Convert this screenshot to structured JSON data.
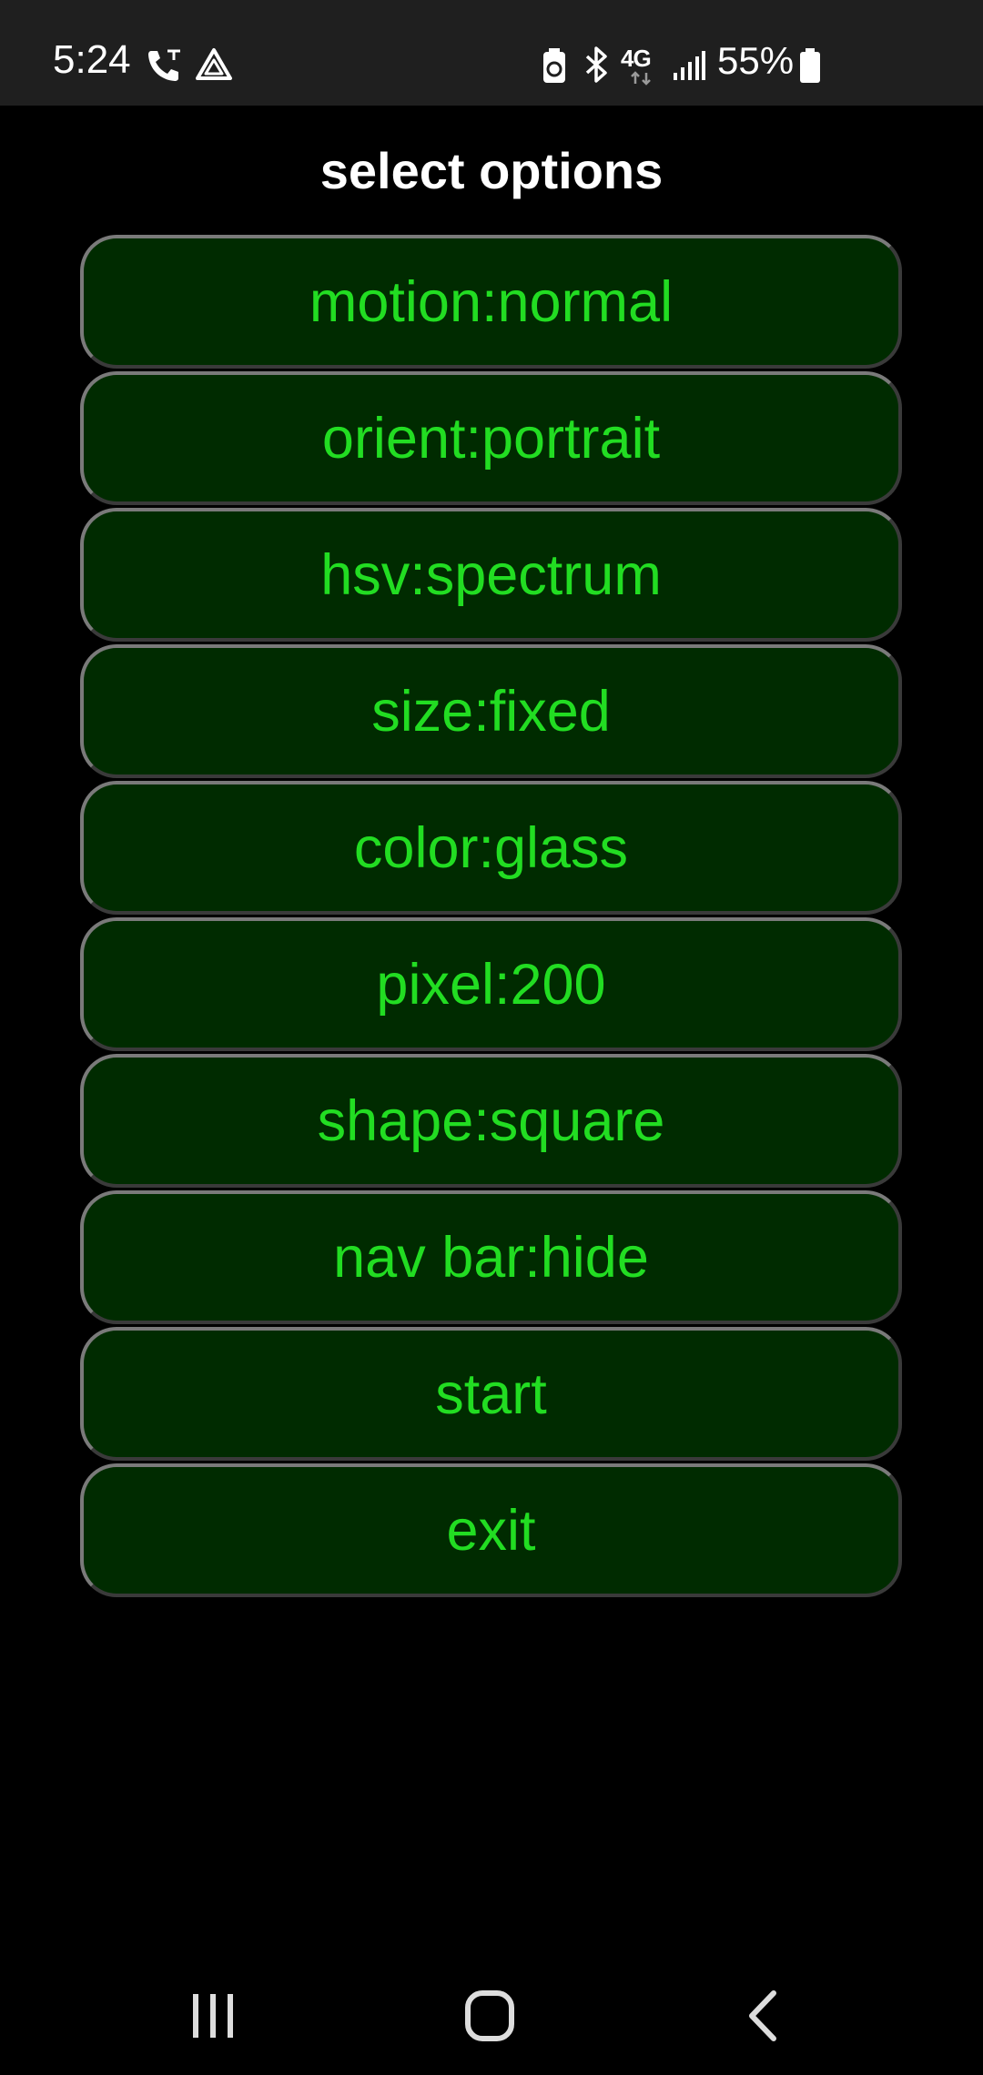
{
  "status_bar": {
    "time": "5:24",
    "network_label": "4G",
    "battery_percent": "55%",
    "icons": [
      "phone-call-icon",
      "drive-icon",
      "battery-saver-icon",
      "bluetooth-icon",
      "network-4g-icon",
      "signal-bars-icon",
      "battery-icon"
    ]
  },
  "page": {
    "title": "select options"
  },
  "options": [
    {
      "label": "motion:normal"
    },
    {
      "label": "orient:portrait"
    },
    {
      "label": "hsv:spectrum"
    },
    {
      "label": "size:fixed"
    },
    {
      "label": "color:glass"
    },
    {
      "label": "pixel:200"
    },
    {
      "label": "shape:square"
    },
    {
      "label": "nav bar:hide"
    },
    {
      "label": "start"
    },
    {
      "label": "exit"
    }
  ],
  "nav_bar": {
    "icons": [
      "recent-apps-icon",
      "home-icon",
      "back-icon"
    ]
  },
  "colors": {
    "button_background": "#002b00",
    "button_text": "#22dd22",
    "button_border": "#7a7a7a",
    "page_background": "#000000",
    "status_bar_background": "#1f1f1f"
  }
}
